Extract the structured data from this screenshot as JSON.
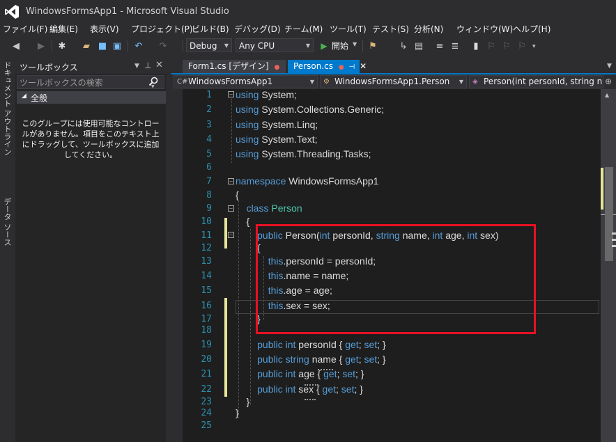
{
  "window": {
    "title": "WindowsFormsApp1 - Microsoft Visual Studio"
  },
  "menu": [
    "ファイル(F)",
    "編集(E)",
    "表示(V)",
    "プロジェクト(P)",
    "ビルド(B)",
    "デバッグ(D)",
    "チーム(M)",
    "ツール(T)",
    "テスト(S)",
    "分析(N)",
    "ウィンドウ(W)",
    "ヘルプ(H)"
  ],
  "toolbar": {
    "configuration": "Debug",
    "platform": "Any CPU",
    "start_label": "開始"
  },
  "side_tabs": [
    "ドキュメント アウトライン",
    "データ ソース"
  ],
  "toolbox": {
    "title": "ツールボックス",
    "search_placeholder": "ツールボックスの検索",
    "group": "全般",
    "empty_message": "このグループには使用可能なコントロールがありません。項目をこのテキスト上にドラッグして、ツールボックスに追加してください。"
  },
  "tabs": [
    {
      "label": "Form1.cs [デザイン]",
      "active": false
    },
    {
      "label": "Person.cs",
      "active": true
    }
  ],
  "navbar": {
    "project": "WindowsFormsApp1",
    "class": "WindowsFormsApp1.Person",
    "member": "Person(int personId, string name,"
  },
  "editor": {
    "line_numbers": [
      "1",
      "2",
      "3",
      "4",
      "5",
      "6",
      "7",
      "8",
      "9",
      "10",
      "11",
      "12",
      "13",
      "14",
      "15",
      "16",
      "17",
      "18",
      "19",
      "20",
      "21",
      "22",
      "23",
      "24",
      "25"
    ],
    "lines": [
      [
        {
          "t": "using",
          "c": "kw"
        },
        {
          "t": " System;"
        }
      ],
      [
        {
          "t": "using",
          "c": "kw"
        },
        {
          "t": " System.Collections.Generic;"
        }
      ],
      [
        {
          "t": "using",
          "c": "kw"
        },
        {
          "t": " System.Linq;"
        }
      ],
      [
        {
          "t": "using",
          "c": "kw"
        },
        {
          "t": " System.Text;"
        }
      ],
      [
        {
          "t": "using",
          "c": "kw"
        },
        {
          "t": " System.Threading.Tasks;"
        }
      ],
      [],
      [
        {
          "t": "namespace",
          "c": "kw"
        },
        {
          "t": " WindowsFormsApp1"
        }
      ],
      [
        {
          "t": "{"
        }
      ],
      [
        {
          "t": "    "
        },
        {
          "t": "class",
          "c": "kw"
        },
        {
          "t": " "
        },
        {
          "t": "Person",
          "c": "ty"
        }
      ],
      [
        {
          "t": "    {"
        }
      ],
      [
        {
          "t": "        "
        },
        {
          "t": "public",
          "c": "kw"
        },
        {
          "t": " Person("
        },
        {
          "t": "int",
          "c": "kw"
        },
        {
          "t": " personId, "
        },
        {
          "t": "string",
          "c": "kw"
        },
        {
          "t": " name, "
        },
        {
          "t": "int",
          "c": "kw"
        },
        {
          "t": " age, "
        },
        {
          "t": "int",
          "c": "kw"
        },
        {
          "t": " sex)"
        }
      ],
      [
        {
          "t": "        {"
        }
      ],
      [
        {
          "t": "            "
        },
        {
          "t": "this",
          "c": "kw"
        },
        {
          "t": ".personId = personId;"
        }
      ],
      [
        {
          "t": "            "
        },
        {
          "t": "this",
          "c": "kw"
        },
        {
          "t": ".name = name;"
        }
      ],
      [
        {
          "t": "            "
        },
        {
          "t": "this",
          "c": "kw"
        },
        {
          "t": ".age = age;"
        }
      ],
      [
        {
          "t": "            "
        },
        {
          "t": "this",
          "c": "kw"
        },
        {
          "t": ".sex = sex;"
        }
      ],
      [
        {
          "t": "        }"
        }
      ],
      [],
      [
        {
          "t": "        "
        },
        {
          "t": "public",
          "c": "kw"
        },
        {
          "t": " "
        },
        {
          "t": "int",
          "c": "kw"
        },
        {
          "t": " personId { "
        },
        {
          "t": "get",
          "c": "kw"
        },
        {
          "t": "; "
        },
        {
          "t": "set",
          "c": "kw"
        },
        {
          "t": "; }"
        }
      ],
      [
        {
          "t": "        "
        },
        {
          "t": "public",
          "c": "kw"
        },
        {
          "t": " "
        },
        {
          "t": "string",
          "c": "kw"
        },
        {
          "t": " name { "
        },
        {
          "t": "get",
          "c": "kw"
        },
        {
          "t": "; "
        },
        {
          "t": "set",
          "c": "kw"
        },
        {
          "t": "; }"
        }
      ],
      [
        {
          "t": "        "
        },
        {
          "t": "public",
          "c": "kw"
        },
        {
          "t": " "
        },
        {
          "t": "int",
          "c": "kw"
        },
        {
          "t": " age { "
        },
        {
          "t": "get",
          "c": "kw"
        },
        {
          "t": "; "
        },
        {
          "t": "set",
          "c": "kw"
        },
        {
          "t": "; }"
        }
      ],
      [
        {
          "t": "        "
        },
        {
          "t": "public",
          "c": "kw"
        },
        {
          "t": " "
        },
        {
          "t": "int",
          "c": "kw"
        },
        {
          "t": " sex { "
        },
        {
          "t": "get",
          "c": "kw"
        },
        {
          "t": "; "
        },
        {
          "t": "set",
          "c": "kw"
        },
        {
          "t": "; }"
        }
      ],
      [
        {
          "t": "    }"
        }
      ],
      [
        {
          "t": "}"
        }
      ],
      []
    ]
  },
  "colors": {
    "accent": "#007acc",
    "highlight_box": "#e81123",
    "keyword": "#569cd6",
    "type": "#4ec9b0",
    "line_number": "#2b91af",
    "change_marker": "#e5e59a"
  }
}
